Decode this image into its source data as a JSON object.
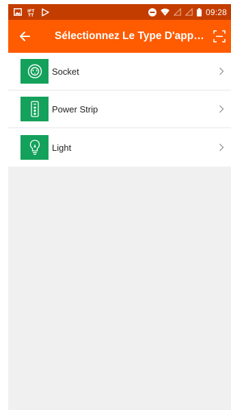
{
  "statusbar": {
    "time": "09:28",
    "icons": [
      "image-icon",
      "ift-icon",
      "play-store-icon",
      "do-not-disturb-icon",
      "wifi-icon",
      "signal-icon",
      "signal-icon",
      "battery-icon"
    ]
  },
  "appbar": {
    "title": "Sélectionnez Le Type D'appa...",
    "back_icon": "arrow-left-icon",
    "scan_icon": "scan-icon",
    "background": "#ff5b00",
    "status_background": "#c43d00"
  },
  "device_types": [
    {
      "label": "Socket",
      "icon": "socket-icon"
    },
    {
      "label": "Power Strip",
      "icon": "power-strip-icon"
    },
    {
      "label": "Light",
      "icon": "light-bulb-icon"
    }
  ],
  "colors": {
    "tile_green": "#14a15b"
  }
}
